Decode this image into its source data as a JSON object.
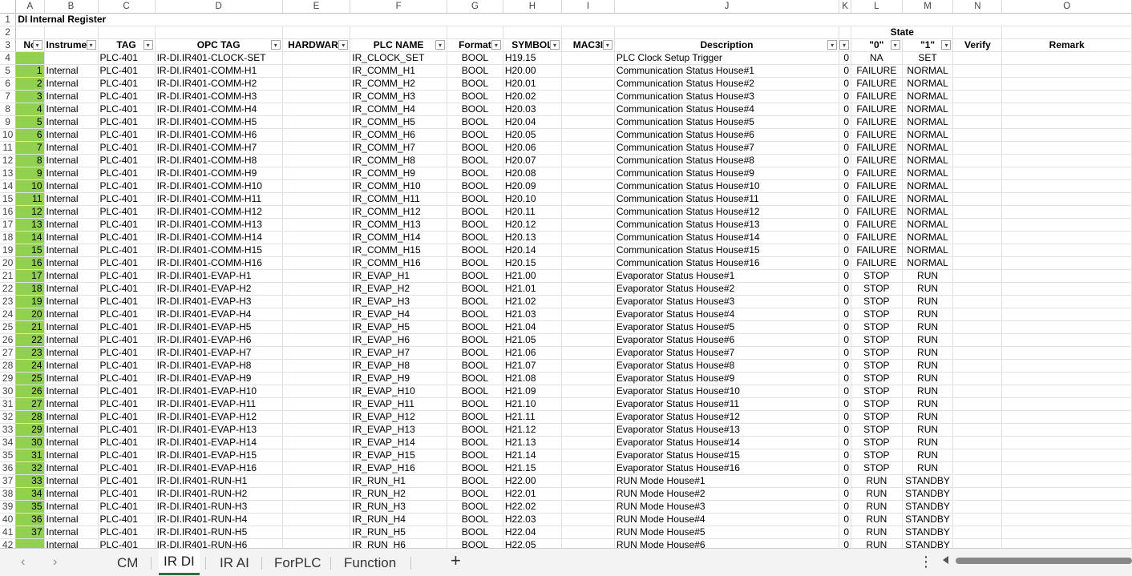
{
  "columns": [
    "A",
    "B",
    "C",
    "D",
    "E",
    "F",
    "G",
    "H",
    "I",
    "J",
    "K",
    "L",
    "M",
    "N",
    "O"
  ],
  "title": "DI Internal Register",
  "state_title": "State",
  "headers": [
    "No",
    "Instrument",
    "TAG",
    "OPC TAG",
    "HARDWARE",
    "PLC NAME",
    "Format",
    "SYMBOL",
    "MAC3I",
    "Description",
    "",
    "\"0\"",
    "\"1\"",
    "Verify",
    "Remark"
  ],
  "rows": [
    {
      "n": "",
      "type": "",
      "tag": "PLC-401",
      "opc": "IR-DI.IR401-CLOCK-SET",
      "hw": "",
      "plc": "IR_CLOCK_SET",
      "fmt": "BOOL",
      "sym": "H19.15",
      "mac": "",
      "desc": "PLC Clock Setup Trigger",
      "k": "0",
      "s0": "NA",
      "s1": "SET"
    },
    {
      "n": "1",
      "type": "Internal",
      "tag": "PLC-401",
      "opc": "IR-DI.IR401-COMM-H1",
      "hw": "",
      "plc": "IR_COMM_H1",
      "fmt": "BOOL",
      "sym": "H20.00",
      "mac": "",
      "desc": "Communication Status House#1",
      "k": "0",
      "s0": "FAILURE",
      "s1": "NORMAL"
    },
    {
      "n": "2",
      "type": "Internal",
      "tag": "PLC-401",
      "opc": "IR-DI.IR401-COMM-H2",
      "hw": "",
      "plc": "IR_COMM_H2",
      "fmt": "BOOL",
      "sym": "H20.01",
      "mac": "",
      "desc": "Communication Status House#2",
      "k": "0",
      "s0": "FAILURE",
      "s1": "NORMAL"
    },
    {
      "n": "3",
      "type": "Internal",
      "tag": "PLC-401",
      "opc": "IR-DI.IR401-COMM-H3",
      "hw": "",
      "plc": "IR_COMM_H3",
      "fmt": "BOOL",
      "sym": "H20.02",
      "mac": "",
      "desc": "Communication Status House#3",
      "k": "0",
      "s0": "FAILURE",
      "s1": "NORMAL"
    },
    {
      "n": "4",
      "type": "Internal",
      "tag": "PLC-401",
      "opc": "IR-DI.IR401-COMM-H4",
      "hw": "",
      "plc": "IR_COMM_H4",
      "fmt": "BOOL",
      "sym": "H20.03",
      "mac": "",
      "desc": "Communication Status House#4",
      "k": "0",
      "s0": "FAILURE",
      "s1": "NORMAL"
    },
    {
      "n": "5",
      "type": "Internal",
      "tag": "PLC-401",
      "opc": "IR-DI.IR401-COMM-H5",
      "hw": "",
      "plc": "IR_COMM_H5",
      "fmt": "BOOL",
      "sym": "H20.04",
      "mac": "",
      "desc": "Communication Status House#5",
      "k": "0",
      "s0": "FAILURE",
      "s1": "NORMAL"
    },
    {
      "n": "6",
      "type": "Internal",
      "tag": "PLC-401",
      "opc": "IR-DI.IR401-COMM-H6",
      "hw": "",
      "plc": "IR_COMM_H6",
      "fmt": "BOOL",
      "sym": "H20.05",
      "mac": "",
      "desc": "Communication Status House#6",
      "k": "0",
      "s0": "FAILURE",
      "s1": "NORMAL"
    },
    {
      "n": "7",
      "type": "Internal",
      "tag": "PLC-401",
      "opc": "IR-DI.IR401-COMM-H7",
      "hw": "",
      "plc": "IR_COMM_H7",
      "fmt": "BOOL",
      "sym": "H20.06",
      "mac": "",
      "desc": "Communication Status House#7",
      "k": "0",
      "s0": "FAILURE",
      "s1": "NORMAL"
    },
    {
      "n": "8",
      "type": "Internal",
      "tag": "PLC-401",
      "opc": "IR-DI.IR401-COMM-H8",
      "hw": "",
      "plc": "IR_COMM_H8",
      "fmt": "BOOL",
      "sym": "H20.07",
      "mac": "",
      "desc": "Communication Status House#8",
      "k": "0",
      "s0": "FAILURE",
      "s1": "NORMAL"
    },
    {
      "n": "9",
      "type": "Internal",
      "tag": "PLC-401",
      "opc": "IR-DI.IR401-COMM-H9",
      "hw": "",
      "plc": "IR_COMM_H9",
      "fmt": "BOOL",
      "sym": "H20.08",
      "mac": "",
      "desc": "Communication Status House#9",
      "k": "0",
      "s0": "FAILURE",
      "s1": "NORMAL"
    },
    {
      "n": "10",
      "type": "Internal",
      "tag": "PLC-401",
      "opc": "IR-DI.IR401-COMM-H10",
      "hw": "",
      "plc": "IR_COMM_H10",
      "fmt": "BOOL",
      "sym": "H20.09",
      "mac": "",
      "desc": "Communication Status House#10",
      "k": "0",
      "s0": "FAILURE",
      "s1": "NORMAL"
    },
    {
      "n": "11",
      "type": "Internal",
      "tag": "PLC-401",
      "opc": "IR-DI.IR401-COMM-H11",
      "hw": "",
      "plc": "IR_COMM_H11",
      "fmt": "BOOL",
      "sym": "H20.10",
      "mac": "",
      "desc": "Communication Status House#11",
      "k": "0",
      "s0": "FAILURE",
      "s1": "NORMAL"
    },
    {
      "n": "12",
      "type": "Internal",
      "tag": "PLC-401",
      "opc": "IR-DI.IR401-COMM-H12",
      "hw": "",
      "plc": "IR_COMM_H12",
      "fmt": "BOOL",
      "sym": "H20.11",
      "mac": "",
      "desc": "Communication Status House#12",
      "k": "0",
      "s0": "FAILURE",
      "s1": "NORMAL"
    },
    {
      "n": "13",
      "type": "Internal",
      "tag": "PLC-401",
      "opc": "IR-DI.IR401-COMM-H13",
      "hw": "",
      "plc": "IR_COMM_H13",
      "fmt": "BOOL",
      "sym": "H20.12",
      "mac": "",
      "desc": "Communication Status House#13",
      "k": "0",
      "s0": "FAILURE",
      "s1": "NORMAL"
    },
    {
      "n": "14",
      "type": "Internal",
      "tag": "PLC-401",
      "opc": "IR-DI.IR401-COMM-H14",
      "hw": "",
      "plc": "IR_COMM_H14",
      "fmt": "BOOL",
      "sym": "H20.13",
      "mac": "",
      "desc": "Communication Status House#14",
      "k": "0",
      "s0": "FAILURE",
      "s1": "NORMAL"
    },
    {
      "n": "15",
      "type": "Internal",
      "tag": "PLC-401",
      "opc": "IR-DI.IR401-COMM-H15",
      "hw": "",
      "plc": "IR_COMM_H15",
      "fmt": "BOOL",
      "sym": "H20.14",
      "mac": "",
      "desc": "Communication Status House#15",
      "k": "0",
      "s0": "FAILURE",
      "s1": "NORMAL"
    },
    {
      "n": "16",
      "type": "Internal",
      "tag": "PLC-401",
      "opc": "IR-DI.IR401-COMM-H16",
      "hw": "",
      "plc": "IR_COMM_H16",
      "fmt": "BOOL",
      "sym": "H20.15",
      "mac": "",
      "desc": "Communication Status House#16",
      "k": "0",
      "s0": "FAILURE",
      "s1": "NORMAL"
    },
    {
      "n": "17",
      "type": "Internal",
      "tag": "PLC-401",
      "opc": "IR-DI.IR401-EVAP-H1",
      "hw": "",
      "plc": "IR_EVAP_H1",
      "fmt": "BOOL",
      "sym": "H21.00",
      "mac": "",
      "desc": "Evaporator Status House#1",
      "k": "0",
      "s0": "STOP",
      "s1": "RUN"
    },
    {
      "n": "18",
      "type": "Internal",
      "tag": "PLC-401",
      "opc": "IR-DI.IR401-EVAP-H2",
      "hw": "",
      "plc": "IR_EVAP_H2",
      "fmt": "BOOL",
      "sym": "H21.01",
      "mac": "",
      "desc": "Evaporator Status House#2",
      "k": "0",
      "s0": "STOP",
      "s1": "RUN"
    },
    {
      "n": "19",
      "type": "Internal",
      "tag": "PLC-401",
      "opc": "IR-DI.IR401-EVAP-H3",
      "hw": "",
      "plc": "IR_EVAP_H3",
      "fmt": "BOOL",
      "sym": "H21.02",
      "mac": "",
      "desc": "Evaporator Status House#3",
      "k": "0",
      "s0": "STOP",
      "s1": "RUN"
    },
    {
      "n": "20",
      "type": "Internal",
      "tag": "PLC-401",
      "opc": "IR-DI.IR401-EVAP-H4",
      "hw": "",
      "plc": "IR_EVAP_H4",
      "fmt": "BOOL",
      "sym": "H21.03",
      "mac": "",
      "desc": "Evaporator Status House#4",
      "k": "0",
      "s0": "STOP",
      "s1": "RUN"
    },
    {
      "n": "21",
      "type": "Internal",
      "tag": "PLC-401",
      "opc": "IR-DI.IR401-EVAP-H5",
      "hw": "",
      "plc": "IR_EVAP_H5",
      "fmt": "BOOL",
      "sym": "H21.04",
      "mac": "",
      "desc": "Evaporator Status House#5",
      "k": "0",
      "s0": "STOP",
      "s1": "RUN"
    },
    {
      "n": "22",
      "type": "Internal",
      "tag": "PLC-401",
      "opc": "IR-DI.IR401-EVAP-H6",
      "hw": "",
      "plc": "IR_EVAP_H6",
      "fmt": "BOOL",
      "sym": "H21.05",
      "mac": "",
      "desc": "Evaporator Status House#6",
      "k": "0",
      "s0": "STOP",
      "s1": "RUN"
    },
    {
      "n": "23",
      "type": "Internal",
      "tag": "PLC-401",
      "opc": "IR-DI.IR401-EVAP-H7",
      "hw": "",
      "plc": "IR_EVAP_H7",
      "fmt": "BOOL",
      "sym": "H21.06",
      "mac": "",
      "desc": "Evaporator Status House#7",
      "k": "0",
      "s0": "STOP",
      "s1": "RUN"
    },
    {
      "n": "24",
      "type": "Internal",
      "tag": "PLC-401",
      "opc": "IR-DI.IR401-EVAP-H8",
      "hw": "",
      "plc": "IR_EVAP_H8",
      "fmt": "BOOL",
      "sym": "H21.07",
      "mac": "",
      "desc": "Evaporator Status House#8",
      "k": "0",
      "s0": "STOP",
      "s1": "RUN"
    },
    {
      "n": "25",
      "type": "Internal",
      "tag": "PLC-401",
      "opc": "IR-DI.IR401-EVAP-H9",
      "hw": "",
      "plc": "IR_EVAP_H9",
      "fmt": "BOOL",
      "sym": "H21.08",
      "mac": "",
      "desc": "Evaporator Status House#9",
      "k": "0",
      "s0": "STOP",
      "s1": "RUN"
    },
    {
      "n": "26",
      "type": "Internal",
      "tag": "PLC-401",
      "opc": "IR-DI.IR401-EVAP-H10",
      "hw": "",
      "plc": "IR_EVAP_H10",
      "fmt": "BOOL",
      "sym": "H21.09",
      "mac": "",
      "desc": "Evaporator Status House#10",
      "k": "0",
      "s0": "STOP",
      "s1": "RUN"
    },
    {
      "n": "27",
      "type": "Internal",
      "tag": "PLC-401",
      "opc": "IR-DI.IR401-EVAP-H11",
      "hw": "",
      "plc": "IR_EVAP_H11",
      "fmt": "BOOL",
      "sym": "H21.10",
      "mac": "",
      "desc": "Evaporator Status House#11",
      "k": "0",
      "s0": "STOP",
      "s1": "RUN"
    },
    {
      "n": "28",
      "type": "Internal",
      "tag": "PLC-401",
      "opc": "IR-DI.IR401-EVAP-H12",
      "hw": "",
      "plc": "IR_EVAP_H12",
      "fmt": "BOOL",
      "sym": "H21.11",
      "mac": "",
      "desc": "Evaporator Status House#12",
      "k": "0",
      "s0": "STOP",
      "s1": "RUN"
    },
    {
      "n": "29",
      "type": "Internal",
      "tag": "PLC-401",
      "opc": "IR-DI.IR401-EVAP-H13",
      "hw": "",
      "plc": "IR_EVAP_H13",
      "fmt": "BOOL",
      "sym": "H21.12",
      "mac": "",
      "desc": "Evaporator Status House#13",
      "k": "0",
      "s0": "STOP",
      "s1": "RUN"
    },
    {
      "n": "30",
      "type": "Internal",
      "tag": "PLC-401",
      "opc": "IR-DI.IR401-EVAP-H14",
      "hw": "",
      "plc": "IR_EVAP_H14",
      "fmt": "BOOL",
      "sym": "H21.13",
      "mac": "",
      "desc": "Evaporator Status House#14",
      "k": "0",
      "s0": "STOP",
      "s1": "RUN"
    },
    {
      "n": "31",
      "type": "Internal",
      "tag": "PLC-401",
      "opc": "IR-DI.IR401-EVAP-H15",
      "hw": "",
      "plc": "IR_EVAP_H15",
      "fmt": "BOOL",
      "sym": "H21.14",
      "mac": "",
      "desc": "Evaporator Status House#15",
      "k": "0",
      "s0": "STOP",
      "s1": "RUN"
    },
    {
      "n": "32",
      "type": "Internal",
      "tag": "PLC-401",
      "opc": "IR-DI.IR401-EVAP-H16",
      "hw": "",
      "plc": "IR_EVAP_H16",
      "fmt": "BOOL",
      "sym": "H21.15",
      "mac": "",
      "desc": "Evaporator Status House#16",
      "k": "0",
      "s0": "STOP",
      "s1": "RUN"
    },
    {
      "n": "33",
      "type": "Internal",
      "tag": "PLC-401",
      "opc": "IR-DI.IR401-RUN-H1",
      "hw": "",
      "plc": "IR_RUN_H1",
      "fmt": "BOOL",
      "sym": "H22.00",
      "mac": "",
      "desc": "RUN Mode House#1",
      "k": "0",
      "s0": "RUN",
      "s1": "STANDBY"
    },
    {
      "n": "34",
      "type": "Internal",
      "tag": "PLC-401",
      "opc": "IR-DI.IR401-RUN-H2",
      "hw": "",
      "plc": "IR_RUN_H2",
      "fmt": "BOOL",
      "sym": "H22.01",
      "mac": "",
      "desc": "RUN Mode House#2",
      "k": "0",
      "s0": "RUN",
      "s1": "STANDBY"
    },
    {
      "n": "35",
      "type": "Internal",
      "tag": "PLC-401",
      "opc": "IR-DI.IR401-RUN-H3",
      "hw": "",
      "plc": "IR_RUN_H3",
      "fmt": "BOOL",
      "sym": "H22.02",
      "mac": "",
      "desc": "RUN Mode House#3",
      "k": "0",
      "s0": "RUN",
      "s1": "STANDBY"
    },
    {
      "n": "36",
      "type": "Internal",
      "tag": "PLC-401",
      "opc": "IR-DI.IR401-RUN-H4",
      "hw": "",
      "plc": "IR_RUN_H4",
      "fmt": "BOOL",
      "sym": "H22.03",
      "mac": "",
      "desc": "RUN Mode House#4",
      "k": "0",
      "s0": "RUN",
      "s1": "STANDBY"
    },
    {
      "n": "37",
      "type": "Internal",
      "tag": "PLC-401",
      "opc": "IR-DI.IR401-RUN-H5",
      "hw": "",
      "plc": "IR_RUN_H5",
      "fmt": "BOOL",
      "sym": "H22.04",
      "mac": "",
      "desc": "RUN Mode House#5",
      "k": "0",
      "s0": "RUN",
      "s1": "STANDBY"
    },
    {
      "n": "",
      "type": "Internal",
      "tag": "PLC-401",
      "opc": "IR-DI.IR401-RUN-H6",
      "hw": "",
      "plc": "IR_RUN_H6",
      "fmt": "BOOL",
      "sym": "H22.05",
      "mac": "",
      "desc": "RUN Mode House#6",
      "k": "0",
      "s0": "RUN",
      "s1": "STANDBY"
    }
  ],
  "tabs": [
    "CM",
    "IR DI",
    "IR AI",
    "ForPLC",
    "Function"
  ],
  "active_tab": "IR DI",
  "nav": {
    "prev": "‹",
    "next": "›",
    "add": "+",
    "more": "⋮"
  },
  "colors": {
    "number_fill": "#92d050",
    "active_tab_underline": "#217346"
  }
}
